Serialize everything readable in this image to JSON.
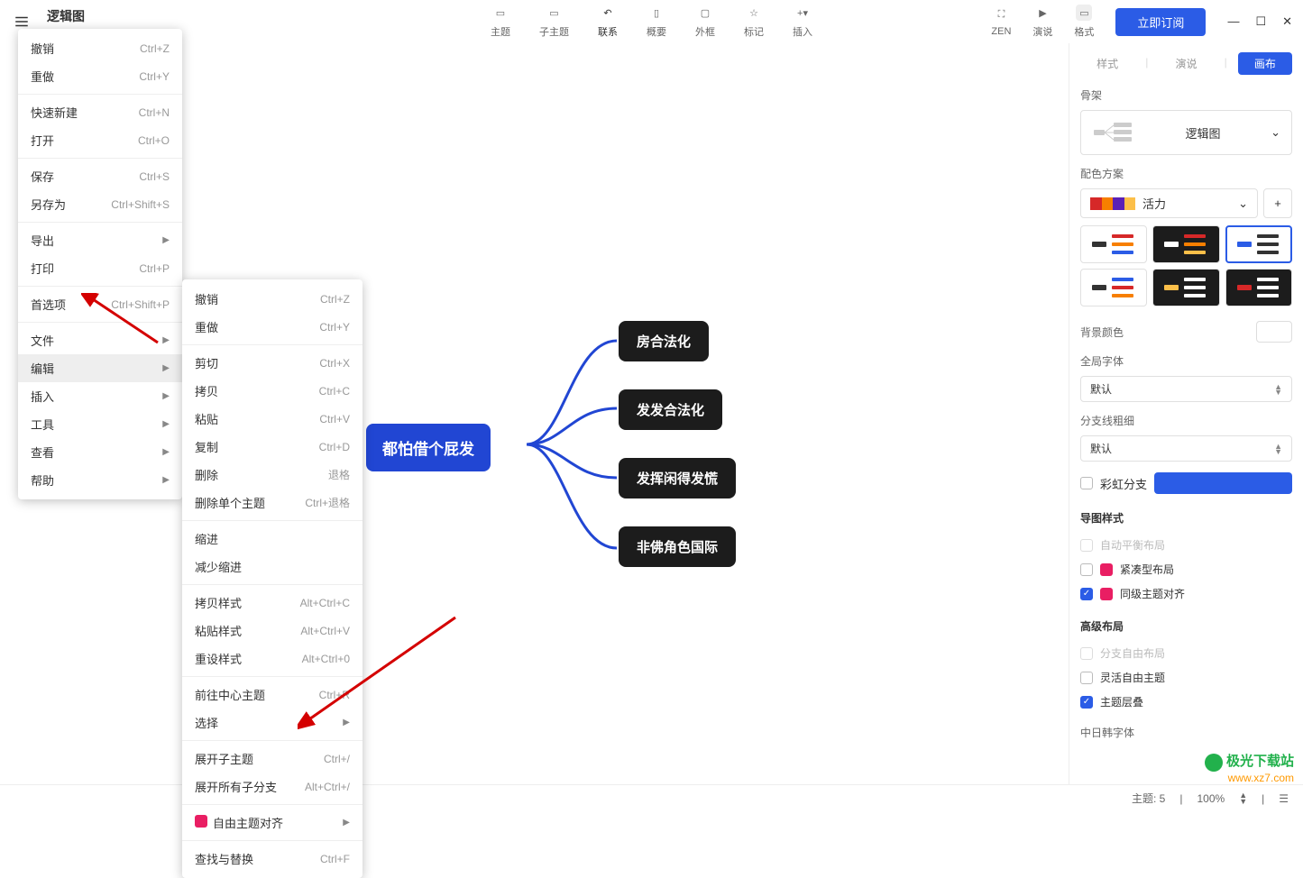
{
  "title": "逻辑图",
  "toolbar": {
    "items": [
      {
        "label": "主题"
      },
      {
        "label": "子主题"
      },
      {
        "label": "联系"
      },
      {
        "label": "概要"
      },
      {
        "label": "外框"
      },
      {
        "label": "标记"
      },
      {
        "label": "插入"
      }
    ],
    "zen": "ZEN",
    "present": "演说",
    "format": "格式",
    "subscribe": "立即订阅"
  },
  "menu1": {
    "undo": {
      "label": "撤销",
      "shortcut": "Ctrl+Z"
    },
    "redo": {
      "label": "重做",
      "shortcut": "Ctrl+Y"
    },
    "quicknew": {
      "label": "快速新建",
      "shortcut": "Ctrl+N"
    },
    "open": {
      "label": "打开",
      "shortcut": "Ctrl+O"
    },
    "save": {
      "label": "保存",
      "shortcut": "Ctrl+S"
    },
    "saveas": {
      "label": "另存为",
      "shortcut": "Ctrl+Shift+S"
    },
    "export": {
      "label": "导出"
    },
    "print": {
      "label": "打印",
      "shortcut": "Ctrl+P"
    },
    "preferences": {
      "label": "首选项",
      "shortcut": "Ctrl+Shift+P"
    },
    "file": {
      "label": "文件"
    },
    "edit": {
      "label": "编辑"
    },
    "insert": {
      "label": "插入"
    },
    "tools": {
      "label": "工具"
    },
    "view": {
      "label": "查看"
    },
    "help": {
      "label": "帮助"
    }
  },
  "menu2": {
    "undo": {
      "label": "撤销",
      "shortcut": "Ctrl+Z"
    },
    "redo": {
      "label": "重做",
      "shortcut": "Ctrl+Y"
    },
    "cut": {
      "label": "剪切",
      "shortcut": "Ctrl+X"
    },
    "copy": {
      "label": "拷贝",
      "shortcut": "Ctrl+C"
    },
    "paste": {
      "label": "粘贴",
      "shortcut": "Ctrl+V"
    },
    "duplicate": {
      "label": "复制",
      "shortcut": "Ctrl+D"
    },
    "delete": {
      "label": "删除",
      "shortcut": "退格"
    },
    "deletesingle": {
      "label": "删除单个主题",
      "shortcut": "Ctrl+退格"
    },
    "indent": {
      "label": "缩进"
    },
    "outdent": {
      "label": "减少缩进"
    },
    "copystyle": {
      "label": "拷贝样式",
      "shortcut": "Alt+Ctrl+C"
    },
    "pastestyle": {
      "label": "粘贴样式",
      "shortcut": "Alt+Ctrl+V"
    },
    "resetstyle": {
      "label": "重设样式",
      "shortcut": "Alt+Ctrl+0"
    },
    "gotocenter": {
      "label": "前往中心主题",
      "shortcut": "Ctrl+R"
    },
    "select": {
      "label": "选择"
    },
    "expandsub": {
      "label": "展开子主题",
      "shortcut": "Ctrl+/"
    },
    "expandall": {
      "label": "展开所有子分支",
      "shortcut": "Alt+Ctrl+/"
    },
    "freealign": {
      "label": "自由主题对齐"
    },
    "findreplace": {
      "label": "查找与替换",
      "shortcut": "Ctrl+F"
    }
  },
  "mindmap": {
    "central": "都怕借个屁发",
    "children": [
      "房合法化",
      "发发合法化",
      "发挥闲得发慌",
      "非佛角色国际"
    ]
  },
  "panel": {
    "tabs": {
      "style": "样式",
      "present": "演说",
      "canvas": "画布"
    },
    "skeleton": {
      "title": "骨架",
      "label": "逻辑图"
    },
    "colorscheme": {
      "title": "配色方案",
      "label": "活力"
    },
    "bgcolor": {
      "title": "背景颜色"
    },
    "globalfont": {
      "title": "全局字体",
      "value": "默认"
    },
    "branchwidth": {
      "title": "分支线粗细",
      "value": "默认"
    },
    "rainbow": "彩虹分支",
    "mapstyle": {
      "title": "导图样式",
      "autobalance": "自动平衡布局",
      "compact": "紧凑型布局",
      "samelevel": "同级主题对齐"
    },
    "advanced": {
      "title": "高级布局",
      "branchfree": "分支自由布局",
      "flexfree": "灵活自由主题",
      "overlap": "主题层叠"
    },
    "cjkfont": "中日韩字体"
  },
  "watermark": {
    "title": "极光下载站",
    "url": "www.xz7.com"
  },
  "status": {
    "topics": "主题: 5",
    "zoom": "100%"
  }
}
